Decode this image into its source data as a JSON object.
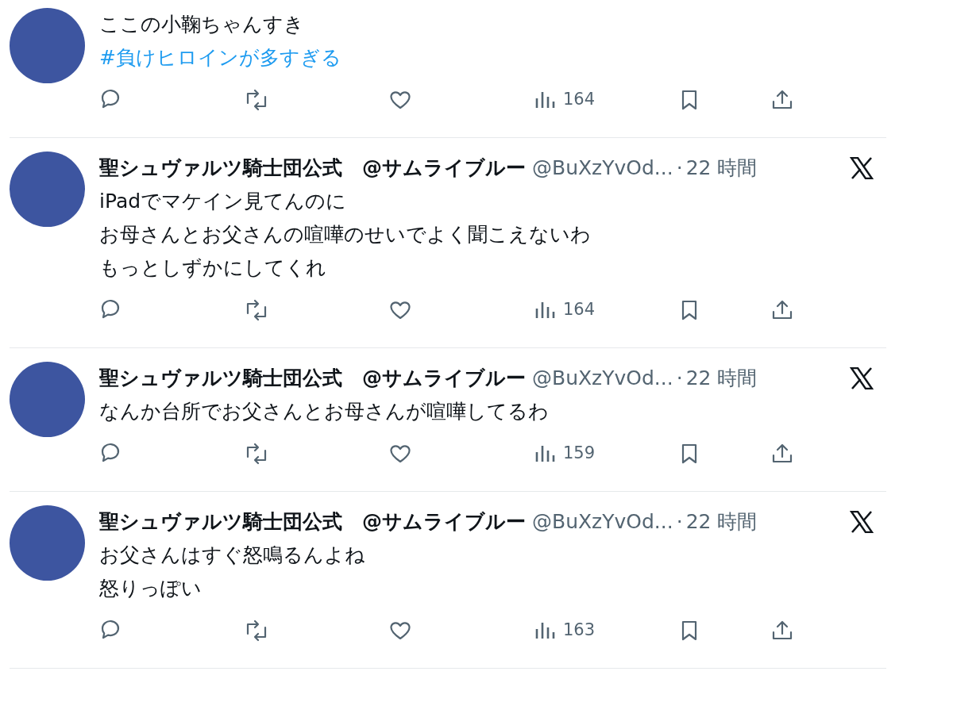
{
  "tweets": [
    {
      "lines": [
        {
          "kind": "text",
          "text": "ここの小鞠ちゃんすき"
        },
        {
          "kind": "hashtag",
          "text": "#負けヒロインが多すぎる"
        }
      ],
      "views": "164"
    },
    {
      "header": {
        "name": "聖シュヴァルツ騎士団公式　@サムライブルー",
        "handle": "@BuXzYvOd...",
        "dot": "·",
        "time": "22 時間"
      },
      "lines": [
        {
          "kind": "text",
          "text": "iPadでマケイン見てんのに"
        },
        {
          "kind": "text",
          "text": "お母さんとお父さんの喧嘩のせいでよく聞こえないわ"
        },
        {
          "kind": "text",
          "text": "もっとしずかにしてくれ"
        }
      ],
      "views": "164"
    },
    {
      "header": {
        "name": "聖シュヴァルツ騎士団公式　@サムライブルー",
        "handle": "@BuXzYvOd...",
        "dot": "·",
        "time": "22 時間"
      },
      "lines": [
        {
          "kind": "text",
          "text": "なんか台所でお父さんとお母さんが喧嘩してるわ"
        }
      ],
      "views": "159"
    },
    {
      "header": {
        "name": "聖シュヴァルツ騎士団公式　@サムライブルー",
        "handle": "@BuXzYvOd...",
        "dot": "·",
        "time": "22 時間"
      },
      "lines": [
        {
          "kind": "text",
          "text": "お父さんはすぐ怒鳴るんよね"
        },
        {
          "kind": "text",
          "text": "怒りっぽい"
        }
      ],
      "views": "163"
    }
  ]
}
